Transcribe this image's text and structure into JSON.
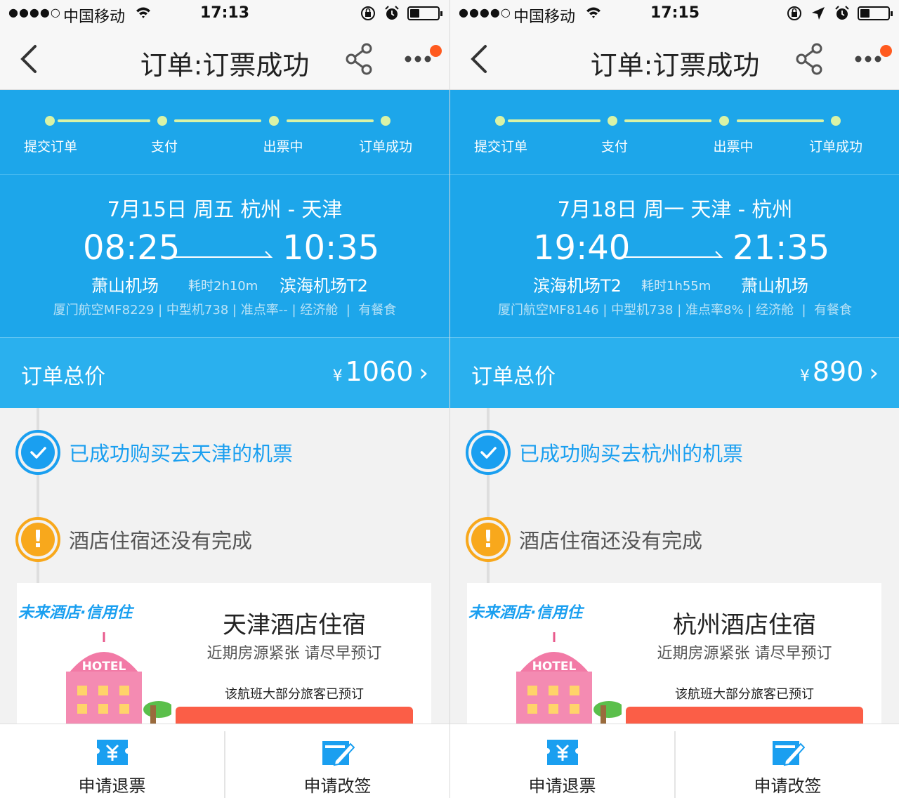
{
  "screens": [
    {
      "status_bar": {
        "signal": "●●●●○",
        "carrier": "中国移动",
        "time": "17:13"
      },
      "nav": {
        "title": "订单:订票成功"
      },
      "progress": {
        "steps": [
          "提交订单",
          "支付",
          "出票中",
          "订单成功"
        ]
      },
      "flight": {
        "route": "7月15日 周五   杭州 - 天津",
        "dep_time": "08:25",
        "arr_time": "10:35",
        "dep_airport": "萧山机场",
        "arr_airport": "滨海机场T2",
        "duration": "耗时2h10m",
        "meta": "厦门航空MF8229 | 中型机738 | 准点率-- | 经济舱  |  有餐食"
      },
      "price": {
        "label": "订单总价",
        "currency": "¥",
        "amount": "1060",
        "chevron": "›"
      },
      "status_success": "已成功购买去天津的机票",
      "status_warn": "酒店住宿还没有完成",
      "warn_mark": "!",
      "hotel": {
        "brand": "未来酒店·信用住",
        "sign": "HOTEL",
        "title": "天津酒店住宿",
        "subtitle": "近期房源紧张 请尽早预订",
        "note": "该航班大部分旅客已预订"
      },
      "bottom": {
        "refund": "申请退票",
        "change": "申请改签"
      }
    },
    {
      "status_bar": {
        "signal": "●●●●○",
        "carrier": "中国移动",
        "time": "17:15"
      },
      "nav": {
        "title": "订单:订票成功"
      },
      "progress": {
        "steps": [
          "提交订单",
          "支付",
          "出票中",
          "订单成功"
        ]
      },
      "flight": {
        "route": "7月18日 周一   天津 - 杭州",
        "dep_time": "19:40",
        "arr_time": "21:35",
        "dep_airport": "滨海机场T2",
        "arr_airport": "萧山机场",
        "duration": "耗时1h55m",
        "meta": "厦门航空MF8146 | 中型机738 | 准点率8% | 经济舱  |  有餐食"
      },
      "price": {
        "label": "订单总价",
        "currency": "¥",
        "amount": "890",
        "chevron": "›"
      },
      "status_success": "已成功购买去杭州的机票",
      "status_warn": "酒店住宿还没有完成",
      "warn_mark": "!",
      "hotel": {
        "brand": "未来酒店·信用住",
        "sign": "HOTEL",
        "title": "杭州酒店住宿",
        "subtitle": "近期房源紧张 请尽早预订",
        "note": "该航班大部分旅客已预订"
      },
      "bottom": {
        "refund": "申请退票",
        "change": "申请改签"
      }
    }
  ],
  "colors": {
    "header_blue": "#1da6ea",
    "price_blue": "#2ab0ee",
    "success_blue": "#1a9ff0",
    "warn_orange": "#f8a81c",
    "badge_orange": "#ff5a1f",
    "button_red": "#fb5e47",
    "progress_green": "#d9f3a6"
  },
  "battery_level": 0.3,
  "icons": [
    "signal-dots-icon",
    "wifi-icon",
    "lock-rotation-icon",
    "location-arrow-icon",
    "alarm-icon",
    "battery-icon",
    "back-chevron-icon",
    "share-icon",
    "more-dots-icon",
    "check-icon",
    "warning-icon",
    "refund-ticket-icon",
    "edit-ticket-icon",
    "hotel-building-icon"
  ]
}
